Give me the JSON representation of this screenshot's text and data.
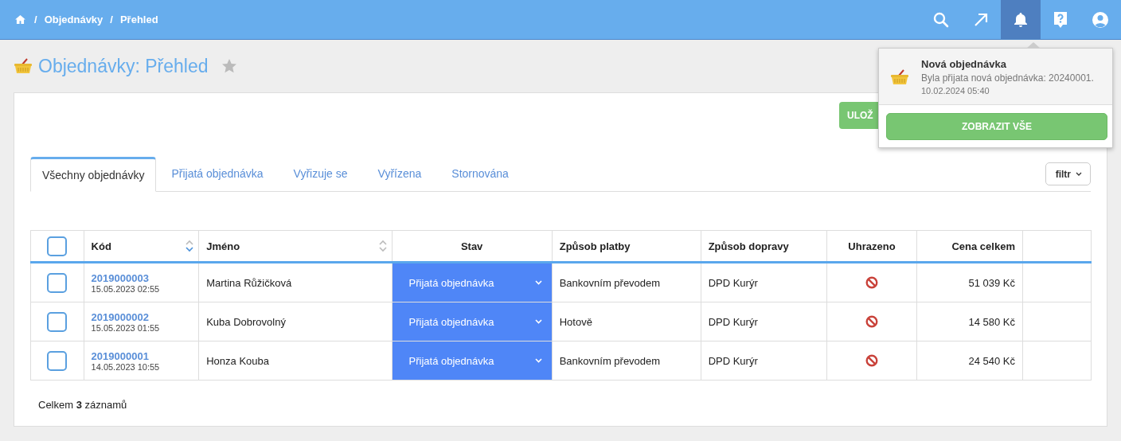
{
  "breadcrumb": {
    "separator": "/",
    "items": [
      "Objednávky",
      "Přehled"
    ]
  },
  "nav_buttons": [
    {
      "kind": "search",
      "selected": false
    },
    {
      "kind": "arrow",
      "selected": false
    },
    {
      "kind": "bell",
      "selected": true
    },
    {
      "kind": "help",
      "selected": false
    },
    {
      "kind": "user",
      "selected": false
    }
  ],
  "page_title": "Objednávky: Přehled",
  "favorite": false,
  "save_button": "ULOŽ",
  "notification": {
    "title": "Nová objednávka",
    "text": "Byla přijata nová objednávka: 20240001.",
    "time": "10.02.2024 05:40",
    "button": "ZOBRAZIT VŠE"
  },
  "tabs": [
    {
      "label": "Všechny objednávky",
      "selected": true
    },
    {
      "label": "Přijatá objednávka",
      "selected": false
    },
    {
      "label": "Vyřizuje se",
      "selected": false
    },
    {
      "label": "Vyřízena",
      "selected": false
    },
    {
      "label": "Stornována",
      "selected": false
    }
  ],
  "filter_button": "filtr",
  "table": {
    "select_all": false,
    "columns": [
      {
        "label": "Kód",
        "sortable": true,
        "sorted_descending": true
      },
      {
        "label": "Jméno",
        "sortable": true,
        "sorted_descending": false
      },
      {
        "label": "Stav",
        "sortable": false
      },
      {
        "label": "Způsob platby",
        "sortable": false
      },
      {
        "label": "Způsob dopravy",
        "sortable": false
      },
      {
        "label": "Uhrazeno",
        "sortable": false
      },
      {
        "label": "Cena celkem",
        "sortable": false
      }
    ],
    "rows": [
      {
        "checked": false,
        "code": "2019000003",
        "date": "15.05.2023 02:55",
        "name": "Martina Růžičková",
        "status": "Přijatá objednávka",
        "payment": "Bankovním převodem",
        "shipping": "DPD Kurýr",
        "paid": false,
        "price": "51 039 Kč"
      },
      {
        "checked": false,
        "code": "2019000002",
        "date": "15.05.2023 01:55",
        "name": "Kuba Dobrovolný",
        "status": "Přijatá objednávka",
        "payment": "Hotově",
        "shipping": "DPD Kurýr",
        "paid": false,
        "price": "14 580 Kč"
      },
      {
        "checked": false,
        "code": "2019000001",
        "date": "14.05.2023 10:55",
        "name": "Honza Kouba",
        "status": "Přijatá objednávka",
        "payment": "Bankovním převodem",
        "shipping": "DPD Kurýr",
        "paid": false,
        "price": "24 540 Kč"
      }
    ]
  },
  "total": "Celkem **3** záznamů"
}
